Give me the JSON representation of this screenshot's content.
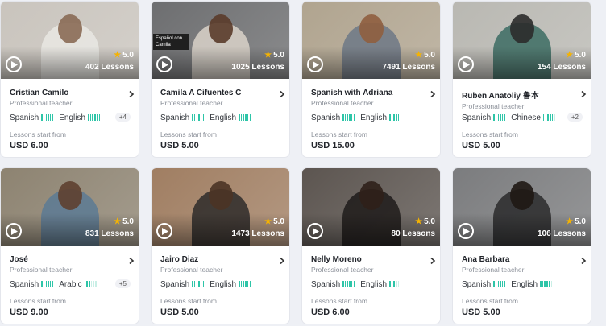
{
  "common": {
    "role": "Professional teacher",
    "start_label": "Lessons start from"
  },
  "colors": {
    "accent_bars": "#2ec5a8",
    "star": "#f5b301"
  },
  "teachers": [
    {
      "name": "Cristian Camilo",
      "rating": "5.0",
      "lessons": "402 Lessons",
      "lang1": "Spanish",
      "lang2": "English",
      "more": "+4",
      "price": "USD 6.00",
      "lang1_level": 6,
      "lang2_level": 6,
      "bg": "#c9c4bd",
      "tone": "#8a6a55",
      "shirt": "#e9e7e3"
    },
    {
      "name": "Camila A Cifuentes C",
      "rating": "5.0",
      "lessons": "1025 Lessons",
      "lang1": "Spanish",
      "lang2": "English",
      "more": "",
      "price": "USD 5.00",
      "caption": "Español con Camila",
      "lang1_level": 6,
      "lang2_level": 6,
      "bg": "#6d6e70",
      "tone": "#5a3b2a",
      "shirt": "#d9d2c9"
    },
    {
      "name": "Spanish with Adriana",
      "rating": "5.0",
      "lessons": "7491 Lessons",
      "lang1": "Spanish",
      "lang2": "English",
      "more": "",
      "price": "USD 15.00",
      "lang1_level": 6,
      "lang2_level": 6,
      "bg": "#b0a48f",
      "tone": "#8f5e3f",
      "shirt": "#6d7886"
    },
    {
      "name": "Ruben Anatoliy 鲁本",
      "rating": "5.0",
      "lessons": "154 Lessons",
      "lang1": "Spanish",
      "lang2": "Chinese",
      "more": "+2",
      "price": "USD 5.00",
      "lang1_level": 6,
      "lang2_level": 5,
      "bg": "#b9b8b2",
      "tone": "#2b2b2b",
      "shirt": "#3c6c63"
    },
    {
      "name": "José",
      "rating": "5.0",
      "lessons": "831 Lessons",
      "lang1": "Spanish",
      "lang2": "Arabic",
      "more": "+5",
      "price": "USD 9.00",
      "lang1_level": 6,
      "lang2_level": 3,
      "bg": "#8d8371",
      "tone": "#5e4030",
      "shirt": "#5c7a94"
    },
    {
      "name": "Jairo Diaz",
      "rating": "5.0",
      "lessons": "1473 Lessons",
      "lang1": "Spanish",
      "lang2": "English",
      "more": "",
      "price": "USD 5.00",
      "lang1_level": 6,
      "lang2_level": 6,
      "bg": "#a07e62",
      "tone": "#4b3425",
      "shirt": "#2e2b2a"
    },
    {
      "name": "Nelly Moreno",
      "rating": "5.0",
      "lessons": "80 Lessons",
      "lang1": "Spanish",
      "lang2": "English",
      "more": "",
      "price": "USD 6.00",
      "lang1_level": 6,
      "lang2_level": 3,
      "bg": "#5c5550",
      "tone": "#2f2019",
      "shirt": "#1e1b1a"
    },
    {
      "name": "Ana Barbara",
      "rating": "5.0",
      "lessons": "106 Lessons",
      "lang1": "Spanish",
      "lang2": "English",
      "more": "",
      "price": "USD 5.00",
      "lang1_level": 6,
      "lang2_level": 5,
      "bg": "#7b7c7e",
      "tone": "#1f1814",
      "shirt": "#2a2a2c"
    }
  ]
}
